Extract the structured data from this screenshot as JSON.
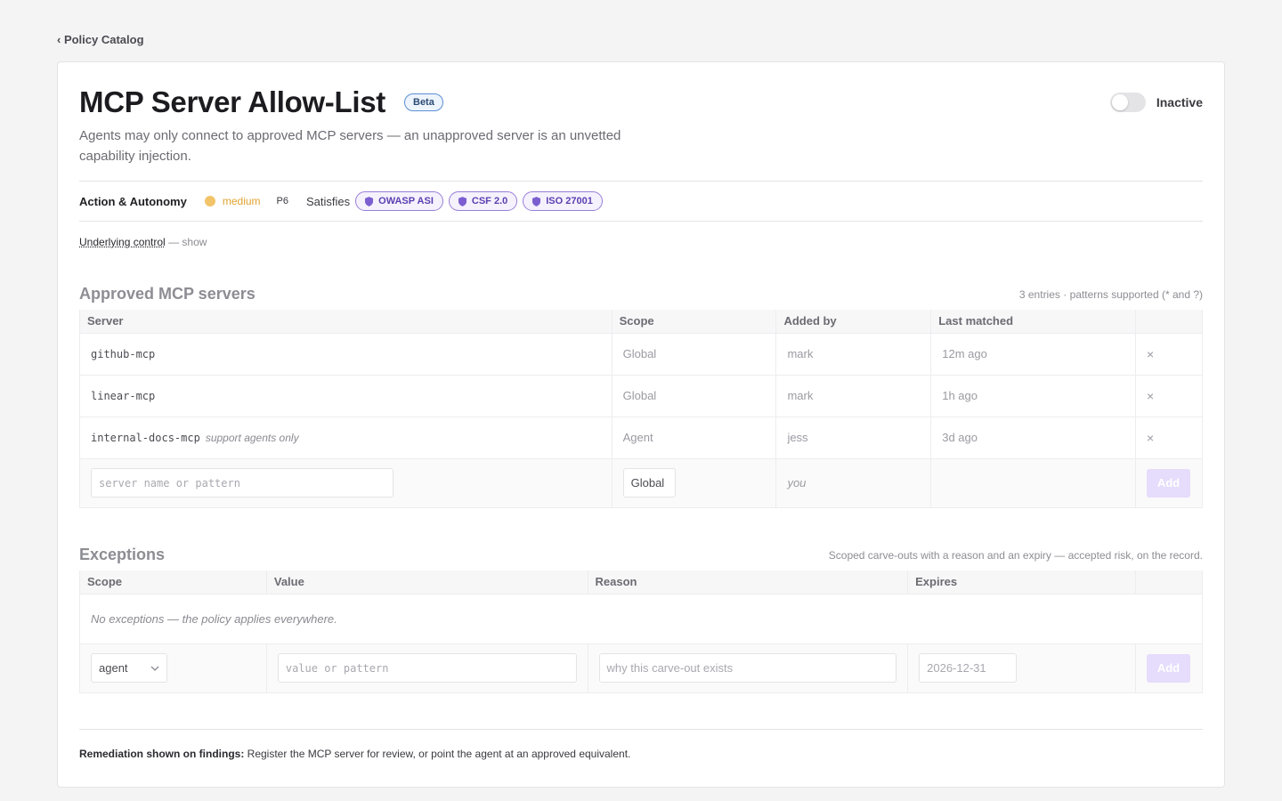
{
  "breadcrumb": {
    "back_label": "‹ Policy Catalog"
  },
  "header": {
    "title": "MCP Server Allow-List",
    "badge": "Beta",
    "description": "Agents may only connect to approved MCP servers — an unapproved server is an unvetted capability injection.",
    "toggle": {
      "label": "Inactive",
      "on": false
    }
  },
  "meta": {
    "category": "Action & Autonomy",
    "severity": "medium",
    "severity_color": "#f2c46a",
    "priority": "P6",
    "satisfies_label": "Satisfies",
    "frameworks": [
      "OWASP ASI",
      "CSF 2.0",
      "ISO 27001"
    ]
  },
  "underlying": {
    "link": "Underlying control",
    "suffix": "— show"
  },
  "servers": {
    "title": "Approved MCP servers",
    "note": "3 entries · patterns supported (* and ?)",
    "columns": [
      "Server",
      "Scope",
      "Added by",
      "Last matched"
    ],
    "rows": [
      {
        "server": "github-mcp",
        "note": "",
        "scope": "Global",
        "added_by": "mark",
        "last_matched": "12m ago"
      },
      {
        "server": "linear-mcp",
        "note": "",
        "scope": "Global",
        "added_by": "mark",
        "last_matched": "1h ago"
      },
      {
        "server": "internal-docs-mcp",
        "note": "support agents only",
        "scope": "Agent",
        "added_by": "jess",
        "last_matched": "3d ago"
      }
    ],
    "remove_glyph": "×",
    "add_row": {
      "placeholder": "server name or pattern",
      "scope": "Global",
      "added_by": "you",
      "button": "Add"
    }
  },
  "exceptions": {
    "title": "Exceptions",
    "note": "Scoped carve-outs with a reason and an expiry — accepted risk, on the record.",
    "columns": [
      "Scope",
      "Value",
      "Reason",
      "Expires"
    ],
    "empty": "No exceptions — the policy applies everywhere.",
    "add_row": {
      "scope": "agent",
      "value_placeholder": "value or pattern",
      "reason_placeholder": "why this carve-out exists",
      "expires_placeholder": "2026-12-31",
      "button": "Add"
    }
  },
  "footer": {
    "label": "Remediation shown on findings:",
    "text": "Register the MCP server for review, or point the agent at an approved equivalent."
  }
}
